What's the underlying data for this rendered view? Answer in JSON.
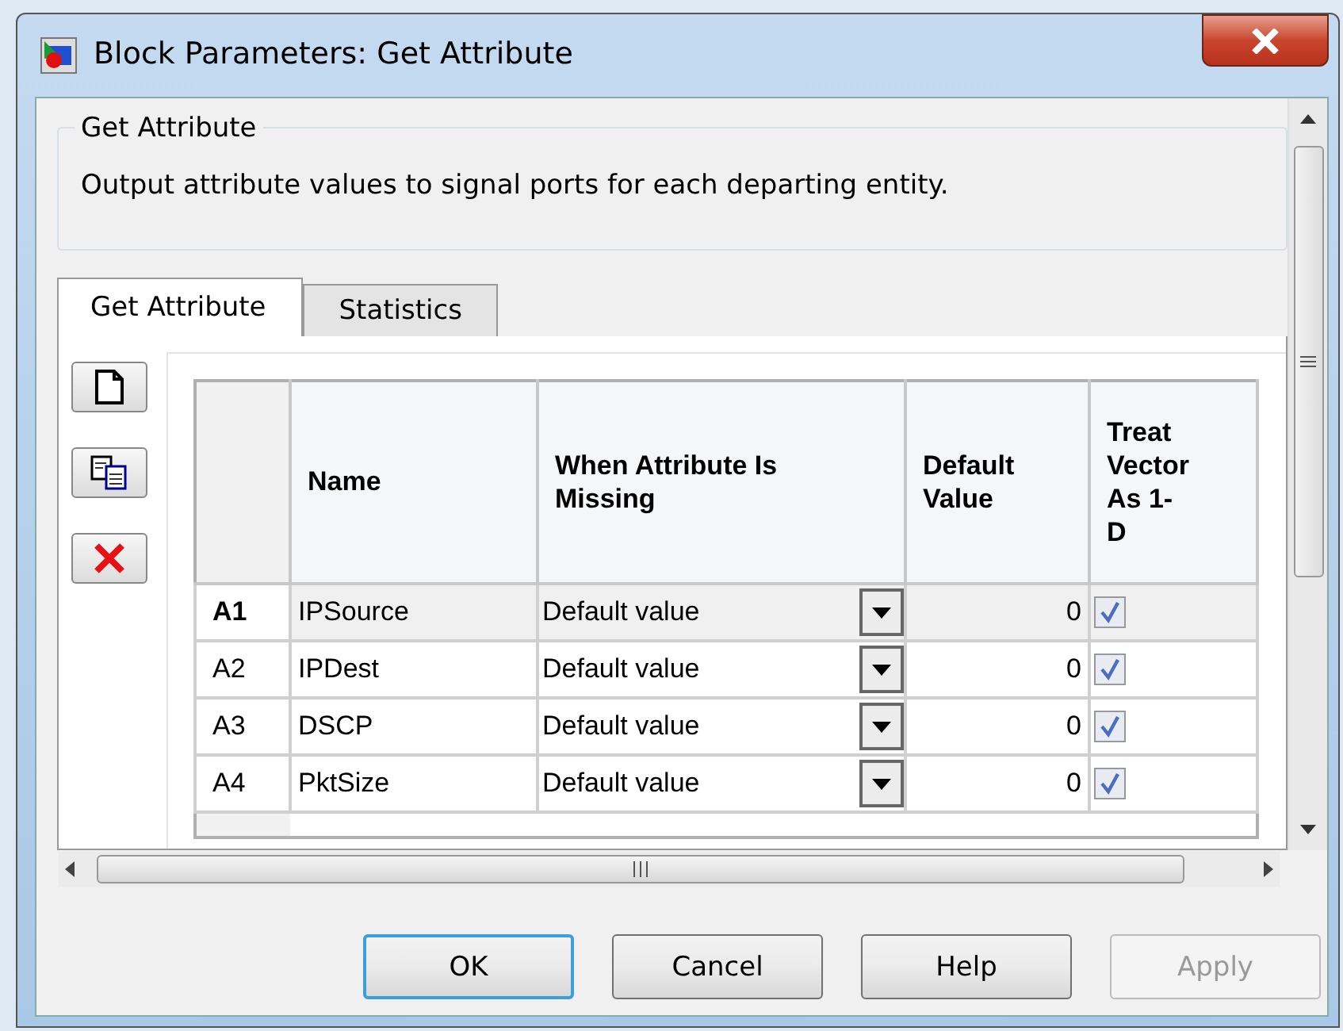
{
  "window": {
    "title": "Block Parameters: Get Attribute"
  },
  "group": {
    "title": "Get Attribute",
    "description": "Output attribute values to signal ports for each departing entity."
  },
  "tabs": [
    {
      "label": "Get Attribute",
      "selected": true
    },
    {
      "label": "Statistics",
      "selected": false
    }
  ],
  "table": {
    "columns": [
      "Name",
      "When Attribute Is Missing",
      "Default Value",
      "Treat Vector As 1-D"
    ],
    "rows": [
      {
        "header": "A1",
        "name": "IPSource",
        "when_missing": "Default value",
        "default_value": "0",
        "treat_vector": true,
        "selected": true
      },
      {
        "header": "A2",
        "name": "IPDest",
        "when_missing": "Default value",
        "default_value": "0",
        "treat_vector": true,
        "selected": false
      },
      {
        "header": "A3",
        "name": "DSCP",
        "when_missing": "Default value",
        "default_value": "0",
        "treat_vector": true,
        "selected": false
      },
      {
        "header": "A4",
        "name": "PktSize",
        "when_missing": "Default value",
        "default_value": "0",
        "treat_vector": true,
        "selected": false
      }
    ]
  },
  "buttons": [
    {
      "label": "OK",
      "default": true,
      "disabled": false
    },
    {
      "label": "Cancel",
      "default": false,
      "disabled": false
    },
    {
      "label": "Help",
      "default": false,
      "disabled": false
    },
    {
      "label": "Apply",
      "default": false,
      "disabled": true
    }
  ]
}
